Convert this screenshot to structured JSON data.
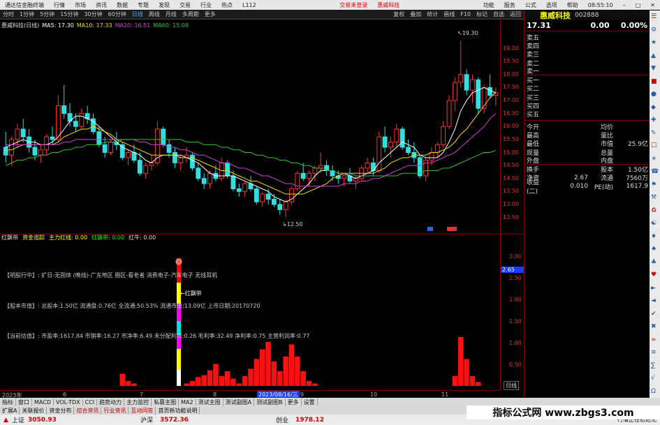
{
  "titlebar": {
    "app": "通达信金融终端",
    "menu": [
      "行情",
      "市场",
      "资讯",
      "数据",
      "专题",
      "发现",
      "交易",
      "行业",
      "热点",
      "L112"
    ],
    "alerts": [
      "交易未登录",
      "惠威科技"
    ],
    "right": [
      "功能",
      "服务",
      "公式",
      "选项",
      "帮助"
    ],
    "time": "08:55:10"
  },
  "toolbar": {
    "left": [
      "分时",
      "1分钟",
      "5分钟",
      "15分钟",
      "30分钟",
      "60分钟",
      "日线",
      "周线",
      "月线",
      "多周期",
      "更多"
    ],
    "right": [
      "复权",
      "叠加",
      "统计",
      "画线",
      "F10",
      "标记",
      "自选",
      "返回"
    ]
  },
  "chart": {
    "title": "惠威科技(日线)",
    "ma": [
      {
        "label": "MA5: 17.30",
        "color": "#ffffff"
      },
      {
        "label": "MA10: 17.33",
        "color": "#ffd700"
      },
      {
        "label": "MA20: 16.51",
        "color": "#d040d0"
      },
      {
        "label": "MA60: 15.08",
        "color": "#30c030"
      }
    ],
    "high_label": "19.30",
    "low_label": "12.50"
  },
  "axis_price": [
    "19.00",
    "18.50",
    "18.00",
    "17.50",
    "17.00",
    "16.50",
    "16.00",
    "15.50",
    "15.00",
    "14.50",
    "14.00",
    "13.50",
    "13.00",
    "12.50"
  ],
  "axis_sub": [
    "3.00",
    "2.50",
    "2.00",
    "1.50",
    "1.00",
    "0.50"
  ],
  "axis_sub_tag": "2.65",
  "subhead": {
    "items": [
      {
        "t": "红飘带",
        "c": "#dddddd"
      },
      {
        "t": "资金追踪",
        "c": "#ffff00"
      },
      {
        "t": "主力红线: 0.00",
        "c": "#ffff00"
      },
      {
        "t": "红飘带: 0.00",
        "c": "#00ff00"
      },
      {
        "t": "红牛: 0.00",
        "c": "#dddddd"
      }
    ]
  },
  "sub_texts": [
    {
      "t": "【明股行中】: 扩日-无固体 (晚线)-广东地区 圈区-看老者 消费电子-汽车电子 无线耳机",
      "c": "#d040d0"
    },
    {
      "t": "【股本市值】: 总股本:1.50亿 流通盘:0.76亿 全流通:50.53% 流通市值:13.09亿 上市日期:20170720",
      "c": "#d040d0"
    },
    {
      "t": "【当前估值】: 市盈率:1617.84 市销率:16.27 市净率:6.49 未分配利润:0.26 毛利率:32.49 净利率:0.75 主营利润率:0.77",
      "c": "#d040d0"
    }
  ],
  "sub_label": "红飘带",
  "xaxis": {
    "labels": [
      "2023年",
      "6",
      "7",
      "8",
      "9",
      "10",
      "11"
    ],
    "cursor": "2023/08/16/三"
  },
  "stock": {
    "name": "惠威科技",
    "code": "002888",
    "price": "17.31",
    "change": "0.00",
    "pct": "0.00%"
  },
  "orderbook": [
    {
      "l": "卖五",
      "p": "",
      "v": ""
    },
    {
      "l": "卖四",
      "p": "",
      "v": ""
    },
    {
      "l": "卖三",
      "p": "",
      "v": ""
    },
    {
      "l": "卖二",
      "p": "",
      "v": ""
    },
    {
      "l": "卖一",
      "p": "",
      "v": ""
    },
    {
      "l": "买一",
      "p": "",
      "v": ""
    },
    {
      "l": "买二",
      "p": "",
      "v": ""
    },
    {
      "l": "买三",
      "p": "",
      "v": ""
    },
    {
      "l": "买四",
      "p": "",
      "v": ""
    },
    {
      "l": "买五",
      "p": "",
      "v": ""
    }
  ],
  "stats": [
    {
      "l1": "今开",
      "v1": "",
      "l2": "均价",
      "v2": ""
    },
    {
      "l1": "最高",
      "v1": "",
      "l2": "量比",
      "v2": ""
    },
    {
      "l1": "最低",
      "v1": "",
      "l2": "市值",
      "v2": "25.9亿"
    },
    {
      "l1": "现量",
      "v1": "",
      "l2": "总量",
      "v2": ""
    },
    {
      "l1": "外盘",
      "v1": "",
      "l2": "内盘",
      "v2": ""
    },
    {
      "l1": "换手",
      "v1": "",
      "l2": "股本",
      "v2": "1.50亿"
    },
    {
      "l1": "净资",
      "v1": "2.67",
      "l2": "流通",
      "v2": "7560万"
    },
    {
      "l1": "收益(二)",
      "v1": "0.010",
      "l2": "PE(动)",
      "v2": "1617.9"
    }
  ],
  "period_btn": "日线",
  "tabs1": [
    "指标",
    "窗口",
    "MACD",
    "VOL-TDX",
    "CCI",
    "趋势动力",
    "主力监控",
    "私募主图",
    "MA2",
    "测试主图",
    "测试副图A",
    "测试副图B",
    "更多",
    "设置"
  ],
  "tabs2": [
    "扩展A",
    "关联报价",
    "资金分布",
    "综合资讯",
    "行业资讯",
    "互动问答",
    "首页新功能说明"
  ],
  "status": {
    "sh_label": "上证",
    "sh_val": "3050.93",
    "hs_label": "沪深",
    "hs_val": "3572.36",
    "cy_label": "创业",
    "cy_val": "1978.12",
    "msg": "行情正在初始化"
  },
  "watermark": "指标公式网 www.zbgs3.com",
  "chart_data": {
    "type": "candlestick",
    "title": "惠威科技(日线)",
    "ylim": [
      12.3,
      19.5
    ],
    "candles": [
      [
        15.2,
        15.8,
        14.6,
        14.9
      ],
      [
        14.9,
        15.6,
        14.5,
        15.5
      ],
      [
        15.5,
        16.1,
        15.2,
        15.9
      ],
      [
        15.9,
        16.3,
        15.4,
        15.6
      ],
      [
        15.6,
        15.9,
        15.0,
        15.2
      ],
      [
        15.2,
        15.5,
        14.7,
        14.9
      ],
      [
        14.9,
        15.3,
        14.6,
        15.1
      ],
      [
        15.1,
        15.7,
        14.9,
        15.6
      ],
      [
        15.6,
        16.0,
        15.3,
        15.5
      ],
      [
        15.5,
        17.2,
        15.4,
        16.8
      ],
      [
        16.8,
        17.6,
        16.3,
        16.5
      ],
      [
        16.5,
        16.9,
        16.0,
        16.2
      ],
      [
        16.2,
        16.5,
        15.8,
        16.0
      ],
      [
        16.0,
        16.7,
        15.9,
        16.5
      ],
      [
        16.5,
        16.8,
        16.1,
        16.3
      ],
      [
        16.3,
        16.5,
        15.7,
        15.8
      ],
      [
        15.8,
        16.0,
        15.2,
        15.3
      ],
      [
        15.3,
        15.6,
        14.8,
        15.0
      ],
      [
        15.0,
        15.5,
        14.9,
        15.4
      ],
      [
        15.4,
        15.8,
        15.1,
        15.3
      ],
      [
        15.3,
        15.4,
        14.7,
        14.8
      ],
      [
        14.8,
        15.1,
        14.5,
        15.0
      ],
      [
        15.0,
        15.3,
        14.6,
        14.7
      ],
      [
        14.7,
        15.0,
        14.1,
        14.2
      ],
      [
        14.2,
        14.6,
        14.0,
        14.5
      ],
      [
        14.5,
        14.9,
        14.3,
        14.6
      ],
      [
        14.6,
        16.2,
        14.5,
        15.9
      ],
      [
        15.9,
        16.0,
        15.2,
        15.3
      ],
      [
        15.3,
        15.5,
        14.8,
        15.0
      ],
      [
        15.0,
        15.2,
        14.4,
        14.6
      ],
      [
        14.6,
        14.9,
        14.3,
        14.8
      ],
      [
        14.8,
        15.2,
        14.6,
        14.9
      ],
      [
        14.9,
        15.0,
        14.3,
        14.4
      ],
      [
        14.4,
        14.6,
        13.9,
        14.0
      ],
      [
        14.0,
        14.2,
        13.6,
        13.8
      ],
      [
        13.8,
        14.3,
        13.6,
        14.2
      ],
      [
        14.2,
        14.5,
        13.9,
        14.0
      ],
      [
        14.0,
        14.8,
        13.9,
        14.6
      ],
      [
        14.6,
        14.7,
        14.0,
        14.1
      ],
      [
        14.1,
        14.3,
        13.5,
        13.6
      ],
      [
        13.6,
        13.8,
        13.3,
        13.5
      ],
      [
        13.5,
        13.9,
        13.3,
        13.8
      ],
      [
        13.8,
        14.1,
        13.5,
        13.6
      ],
      [
        13.6,
        13.7,
        13.0,
        13.1
      ],
      [
        13.1,
        13.5,
        12.9,
        13.4
      ],
      [
        13.4,
        13.6,
        13.0,
        13.2
      ],
      [
        13.2,
        13.4,
        12.9,
        13.0
      ],
      [
        13.0,
        13.2,
        12.6,
        12.8
      ],
      [
        12.8,
        13.2,
        12.5,
        13.1
      ],
      [
        13.1,
        13.7,
        13.0,
        13.6
      ],
      [
        13.6,
        14.3,
        13.5,
        14.2
      ],
      [
        14.2,
        14.6,
        13.9,
        14.0
      ],
      [
        14.0,
        14.3,
        13.7,
        14.2
      ],
      [
        14.2,
        14.5,
        13.9,
        14.4
      ],
      [
        14.4,
        15.0,
        14.2,
        14.5
      ],
      [
        14.5,
        14.7,
        14.1,
        14.3
      ],
      [
        14.3,
        14.5,
        13.9,
        14.1
      ],
      [
        14.1,
        14.3,
        13.8,
        14.0
      ],
      [
        14.0,
        14.2,
        13.7,
        14.1
      ],
      [
        14.1,
        14.4,
        13.8,
        13.9
      ],
      [
        13.9,
        14.1,
        13.6,
        14.0
      ],
      [
        14.0,
        14.5,
        13.9,
        14.4
      ],
      [
        14.4,
        14.8,
        14.2,
        14.6
      ],
      [
        14.6,
        14.8,
        14.1,
        14.3
      ],
      [
        14.3,
        15.8,
        14.2,
        15.6
      ],
      [
        15.6,
        16.0,
        15.0,
        15.2
      ],
      [
        15.2,
        15.6,
        14.8,
        15.4
      ],
      [
        15.4,
        16.1,
        15.2,
        15.9
      ],
      [
        15.9,
        16.0,
        15.1,
        15.2
      ],
      [
        15.2,
        15.5,
        14.9,
        15.0
      ],
      [
        15.0,
        15.4,
        14.6,
        14.8
      ],
      [
        14.8,
        14.9,
        14.0,
        14.1
      ],
      [
        14.1,
        14.8,
        13.9,
        14.7
      ],
      [
        14.7,
        15.2,
        14.5,
        15.0
      ],
      [
        15.0,
        15.4,
        14.8,
        15.3
      ],
      [
        15.3,
        16.2,
        15.2,
        16.0
      ],
      [
        16.0,
        17.2,
        15.9,
        17.0
      ],
      [
        17.0,
        17.9,
        16.6,
        17.7
      ],
      [
        17.7,
        19.3,
        17.5,
        18.0
      ],
      [
        18.0,
        18.2,
        17.2,
        17.4
      ],
      [
        17.4,
        18.0,
        16.9,
        17.8
      ],
      [
        17.8,
        17.9,
        16.5,
        16.7
      ],
      [
        16.7,
        17.6,
        16.5,
        17.5
      ],
      [
        17.5,
        18.0,
        17.1,
        17.2
      ],
      [
        17.2,
        17.5,
        16.8,
        17.3
      ]
    ],
    "ma5": [
      15.2,
      15.3,
      15.4,
      15.5,
      15.4,
      15.4,
      15.3,
      15.3,
      15.4,
      15.6,
      15.9,
      16.2,
      16.4,
      16.4,
      16.3,
      16.2,
      16.0,
      15.8,
      15.6,
      15.4,
      15.2,
      15.1,
      15.0,
      14.9,
      14.7,
      14.6,
      14.8,
      14.9,
      14.9,
      14.9,
      14.9,
      14.8,
      14.7,
      14.6,
      14.4,
      14.2,
      14.1,
      14.1,
      14.1,
      14.1,
      14.0,
      13.9,
      13.8,
      13.7,
      13.6,
      13.5,
      13.3,
      13.2,
      13.1,
      13.2,
      13.4,
      13.6,
      13.8,
      14.1,
      14.3,
      14.3,
      14.3,
      14.2,
      14.2,
      14.1,
      14.0,
      14.1,
      14.2,
      14.3,
      14.6,
      14.8,
      15.0,
      15.2,
      15.4,
      15.3,
      15.2,
      14.9,
      14.8,
      14.8,
      14.8,
      15.0,
      15.4,
      15.9,
      16.6,
      17.0,
      17.3,
      17.4,
      17.5,
      17.4,
      17.3
    ],
    "ma10": [
      15.1,
      15.1,
      15.2,
      15.3,
      15.3,
      15.3,
      15.3,
      15.3,
      15.3,
      15.4,
      15.6,
      15.7,
      15.8,
      15.9,
      15.9,
      16.0,
      15.9,
      15.8,
      15.7,
      15.5,
      15.4,
      15.3,
      15.2,
      15.1,
      15.0,
      14.9,
      14.9,
      14.9,
      14.9,
      14.9,
      14.8,
      14.8,
      14.8,
      14.7,
      14.6,
      14.5,
      14.4,
      14.3,
      14.3,
      14.2,
      14.1,
      14.0,
      13.9,
      13.9,
      13.8,
      13.7,
      13.6,
      13.5,
      13.4,
      13.4,
      13.4,
      13.4,
      13.5,
      13.6,
      13.7,
      13.8,
      14.0,
      14.1,
      14.2,
      14.2,
      14.2,
      14.2,
      14.2,
      14.2,
      14.3,
      14.4,
      14.6,
      14.7,
      14.8,
      14.8,
      14.9,
      14.9,
      14.9,
      15.0,
      15.0,
      15.1,
      15.2,
      15.4,
      15.7,
      15.9,
      16.2,
      16.5,
      16.8,
      17.1,
      17.3
    ],
    "ma20": [
      15.3,
      15.3,
      15.3,
      15.3,
      15.3,
      15.3,
      15.3,
      15.3,
      15.3,
      15.3,
      15.4,
      15.4,
      15.5,
      15.5,
      15.5,
      15.5,
      15.5,
      15.5,
      15.5,
      15.5,
      15.5,
      15.5,
      15.5,
      15.4,
      15.4,
      15.3,
      15.3,
      15.3,
      15.2,
      15.2,
      15.1,
      15.1,
      15.0,
      14.9,
      14.9,
      14.8,
      14.7,
      14.6,
      14.6,
      14.5,
      14.4,
      14.4,
      14.3,
      14.2,
      14.1,
      14.1,
      14.0,
      13.9,
      13.8,
      13.8,
      13.7,
      13.7,
      13.7,
      13.7,
      13.7,
      13.7,
      13.7,
      13.7,
      13.8,
      13.8,
      13.8,
      13.9,
      13.9,
      14.0,
      14.0,
      14.1,
      14.2,
      14.3,
      14.4,
      14.5,
      14.5,
      14.5,
      14.6,
      14.6,
      14.7,
      14.8,
      14.9,
      15.0,
      15.2,
      15.4,
      15.6,
      15.8,
      16.0,
      16.3,
      16.5
    ],
    "ma60": [
      14.5,
      14.6,
      14.7,
      14.7,
      14.8,
      14.8,
      14.9,
      14.9,
      15.0,
      15.0,
      15.1,
      15.1,
      15.2,
      15.2,
      15.3,
      15.3,
      15.3,
      15.4,
      15.4,
      15.4,
      15.5,
      15.5,
      15.5,
      15.5,
      15.5,
      15.5,
      15.5,
      15.5,
      15.5,
      15.5,
      15.5,
      15.4,
      15.4,
      15.4,
      15.3,
      15.3,
      15.3,
      15.2,
      15.2,
      15.1,
      15.1,
      15.0,
      15.0,
      14.9,
      14.9,
      14.8,
      14.8,
      14.7,
      14.7,
      14.6,
      14.6,
      14.5,
      14.5,
      14.4,
      14.4,
      14.3,
      14.3,
      14.2,
      14.2,
      14.2,
      14.1,
      14.1,
      14.1,
      14.1,
      14.1,
      14.1,
      14.1,
      14.1,
      14.2,
      14.2,
      14.2,
      14.2,
      14.3,
      14.3,
      14.3,
      14.4,
      14.4,
      14.5,
      14.6,
      14.7,
      14.8,
      14.9,
      15.0,
      15.0,
      15.08
    ],
    "sub_bars": [
      0,
      0,
      0,
      0,
      0,
      0,
      0,
      0,
      0,
      0,
      0,
      0,
      0,
      0,
      0,
      0,
      0,
      0,
      0,
      0,
      0.25,
      0.1,
      0.05,
      0,
      0,
      0,
      0,
      0,
      0,
      0,
      0,
      0.05,
      0.1,
      0.18,
      0.22,
      0.32,
      0.45,
      0.2,
      0.3,
      0.15,
      0.05,
      0.2,
      0.35,
      0.55,
      0.75,
      0.9,
      0.5,
      0.3,
      0.6,
      0.85,
      0.6,
      0.3,
      0.1,
      0.05,
      0,
      0,
      0,
      0,
      0,
      0,
      0,
      0,
      0,
      0,
      0,
      0,
      0,
      0,
      0,
      0,
      0,
      0,
      0,
      0,
      0,
      0,
      0,
      0.2,
      1.0,
      0.55,
      0.2,
      0.08,
      0,
      0,
      0
    ],
    "sub_ylim": [
      0,
      3.2
    ]
  }
}
